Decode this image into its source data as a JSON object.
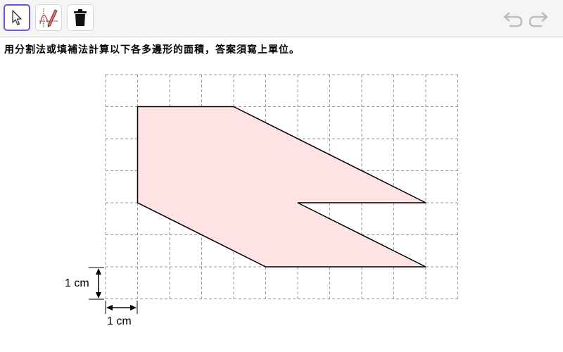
{
  "toolbar": {
    "tools": [
      {
        "name": "move-tool",
        "icon": "cursor-arrow-icon",
        "active": true
      },
      {
        "name": "pen-tool",
        "icon": "pen-graph-icon",
        "active": false
      },
      {
        "name": "delete-tool",
        "icon": "trash-icon",
        "active": false
      }
    ],
    "undo_icon": "undo-arrow-icon",
    "redo_icon": "redo-arrow-icon"
  },
  "instruction": "用分割法或填補法計算以下各多邊形的面積，答案須寫上單位。",
  "figure": {
    "grid_cell_label_vertical": "1 cm",
    "grid_cell_label_horizontal": "1 cm",
    "grid_columns": 11,
    "grid_rows": 7,
    "polygon_vertices_in_grid_units": [
      [
        1,
        1
      ],
      [
        4,
        1
      ],
      [
        10,
        4
      ],
      [
        6,
        4
      ],
      [
        10,
        6
      ],
      [
        5,
        6
      ],
      [
        1,
        4
      ]
    ],
    "fill_color": "#fde3e3",
    "line_color": "#000000",
    "grid_color": "#999999"
  }
}
